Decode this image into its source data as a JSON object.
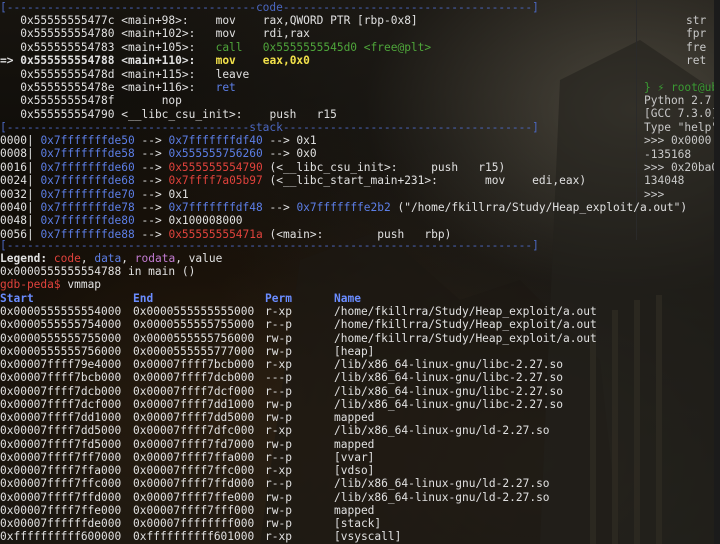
{
  "theme": {
    "separator": "#4b67c0",
    "blue": "#5c7ee6",
    "red": "#e0423c",
    "green": "#4ea53a",
    "yellow": "#f2e14a"
  },
  "code_section": {
    "header": "[-------------------------------------code-------------------------------------]",
    "lines": [
      {
        "marker": "   ",
        "addr": "0x55555555477c",
        "sym": "<main+98>:",
        "op": "mov",
        "args": "rax,QWORD PTR [rbp-0x8]",
        "style": "normal"
      },
      {
        "marker": "   ",
        "addr": "0x555555554780",
        "sym": "<main+102>:",
        "op": "mov",
        "args": "rdi,rax",
        "style": "normal"
      },
      {
        "marker": "   ",
        "addr": "0x555555554783",
        "sym": "<main+105>:",
        "op": "call",
        "args": "0x5555555545d0 <free@plt>",
        "style": "call"
      },
      {
        "marker": "=> ",
        "addr": "0x555555554788",
        "sym": "<main+110>:",
        "op": "mov",
        "args": "eax,0x0",
        "style": "current"
      },
      {
        "marker": "   ",
        "addr": "0x55555555478d",
        "sym": "<main+115>:",
        "op": "leave",
        "args": "",
        "style": "normal"
      },
      {
        "marker": "   ",
        "addr": "0x55555555478e",
        "sym": "<main+116>:",
        "op": "ret",
        "args": "",
        "style": "ret"
      },
      {
        "marker": "   ",
        "addr": "0x55555555478f",
        "sym": "",
        "op": "nop",
        "args": "",
        "style": "normal"
      },
      {
        "marker": "   ",
        "addr": "0x555555554790",
        "sym": "<__libc_csu_init>:",
        "op": "push",
        "args": "r15",
        "style": "normal"
      }
    ]
  },
  "stack_section": {
    "header": "[------------------------------------stack-------------------------------------]",
    "rows": [
      {
        "off": "0000|",
        "addr": "0x7fffffffde50",
        "arrow": "-->",
        "v1": "0x7fffffffdf40",
        "v1c": "blue",
        "rest": " --> 0x1"
      },
      {
        "off": "0008|",
        "addr": "0x7fffffffde58",
        "arrow": "-->",
        "v1": "0x555555756260",
        "v1c": "blue",
        "rest": " --> 0x0"
      },
      {
        "off": "0016|",
        "addr": "0x7fffffffde60",
        "arrow": "-->",
        "v1": "0x555555554790",
        "v1c": "red",
        "rest": " (<__libc_csu_init>:     push   r15)"
      },
      {
        "off": "0024|",
        "addr": "0x7fffffffde68",
        "arrow": "-->",
        "v1": "0x7ffff7a05b97",
        "v1c": "red",
        "rest": " (<__libc_start_main+231>:       mov    edi,eax)"
      },
      {
        "off": "0032|",
        "addr": "0x7fffffffde70",
        "arrow": "-->",
        "v1": "0x1",
        "v1c": "plain",
        "rest": ""
      },
      {
        "off": "0040|",
        "addr": "0x7fffffffde78",
        "arrow": "-->",
        "v1": "0x7fffffffdf48",
        "v1c": "blue",
        "rest": " --> ",
        "v2": "0x7fffffffe2b2",
        "rest2": " (\"/home/fkillrra/Study/Heap_exploit/a.out\")"
      },
      {
        "off": "0048|",
        "addr": "0x7fffffffde80",
        "arrow": "-->",
        "v1": "0x100008000",
        "v1c": "plain",
        "rest": ""
      },
      {
        "off": "0056|",
        "addr": "0x7fffffffde88",
        "arrow": "-->",
        "v1": "0x55555555471a",
        "v1c": "red",
        "rest": " (<main>:        push   rbp)"
      }
    ]
  },
  "footer_sep": "[------------------------------------------------------------------------------]",
  "legend": {
    "prefix": "Legend: ",
    "code": "code",
    "data": "data",
    "rodata": "rodata",
    "value": "value"
  },
  "location": "0x0000555555554788 in main ()",
  "prompt": {
    "text": "gdb-peda$ ",
    "command": "vmmap"
  },
  "vmmap": {
    "headers": {
      "start": "Start",
      "end": "End",
      "perm": "Perm",
      "name": "Name"
    },
    "rows": [
      {
        "start": "0x0000555555554000",
        "end": "0x0000555555555000",
        "perm": "r-xp",
        "name": "/home/fkillrra/Study/Heap_exploit/a.out"
      },
      {
        "start": "0x0000555555754000",
        "end": "0x0000555555755000",
        "perm": "r--p",
        "name": "/home/fkillrra/Study/Heap_exploit/a.out"
      },
      {
        "start": "0x0000555555755000",
        "end": "0x0000555555756000",
        "perm": "rw-p",
        "name": "/home/fkillrra/Study/Heap_exploit/a.out"
      },
      {
        "start": "0x0000555555756000",
        "end": "0x0000555555777000",
        "perm": "rw-p",
        "name": "[heap]"
      },
      {
        "start": "0x00007ffff79e4000",
        "end": "0x00007ffff7bcb000",
        "perm": "r-xp",
        "name": "/lib/x86_64-linux-gnu/libc-2.27.so"
      },
      {
        "start": "0x00007ffff7bcb000",
        "end": "0x00007ffff7dcb000",
        "perm": "---p",
        "name": "/lib/x86_64-linux-gnu/libc-2.27.so"
      },
      {
        "start": "0x00007ffff7dcb000",
        "end": "0x00007ffff7dcf000",
        "perm": "r--p",
        "name": "/lib/x86_64-linux-gnu/libc-2.27.so"
      },
      {
        "start": "0x00007ffff7dcf000",
        "end": "0x00007ffff7dd1000",
        "perm": "rw-p",
        "name": "/lib/x86_64-linux-gnu/libc-2.27.so"
      },
      {
        "start": "0x00007ffff7dd1000",
        "end": "0x00007ffff7dd5000",
        "perm": "rw-p",
        "name": "mapped"
      },
      {
        "start": "0x00007ffff7dd5000",
        "end": "0x00007ffff7dfc000",
        "perm": "r-xp",
        "name": "/lib/x86_64-linux-gnu/ld-2.27.so"
      },
      {
        "start": "0x00007ffff7fd5000",
        "end": "0x00007ffff7fd7000",
        "perm": "rw-p",
        "name": "mapped"
      },
      {
        "start": "0x00007ffff7ff7000",
        "end": "0x00007ffff7ffa000",
        "perm": "r--p",
        "name": "[vvar]"
      },
      {
        "start": "0x00007ffff7ffa000",
        "end": "0x00007ffff7ffc000",
        "perm": "r-xp",
        "name": "[vdso]"
      },
      {
        "start": "0x00007ffff7ffc000",
        "end": "0x00007ffff7ffd000",
        "perm": "r--p",
        "name": "/lib/x86_64-linux-gnu/ld-2.27.so"
      },
      {
        "start": "0x00007ffff7ffd000",
        "end": "0x00007ffff7ffe000",
        "perm": "rw-p",
        "name": "/lib/x86_64-linux-gnu/ld-2.27.so"
      },
      {
        "start": "0x00007ffff7ffe000",
        "end": "0x00007ffff7fff000",
        "perm": "rw-p",
        "name": "mapped"
      },
      {
        "start": "0x00007ffffffde000",
        "end": "0x00007ffffffff000",
        "perm": "rw-p",
        "name": "[stack]"
      },
      {
        "start": "0xffffffffff600000",
        "end": "0xffffffffff601000",
        "perm": "r-xp",
        "name": "[vsyscall]"
      }
    ]
  },
  "right_pane": {
    "top_lines": [
      "str",
      "fpr",
      "fre",
      "ret"
    ],
    "prompt": "root@ub",
    "python_lines": [
      "Python 2.7.",
      "[GCC 7.3.0]",
      "Type \"help\"",
      ">>> 0x0000",
      "-135168",
      ">>> 0x20ba0",
      "134048",
      ">>> "
    ]
  }
}
